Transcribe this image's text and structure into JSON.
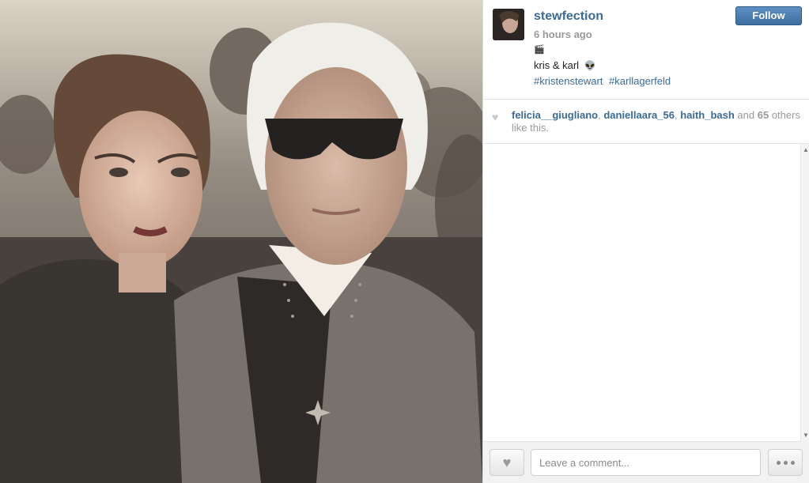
{
  "post": {
    "username": "stewfection",
    "time_ago": "6 hours ago",
    "clapper_emoji": "🎬",
    "caption": "kris & karl",
    "caption_emoji": "👽",
    "hashtags": [
      "#kristenstewart",
      "#karllagerfeld"
    ]
  },
  "header": {
    "follow_label": "Follow"
  },
  "likes": {
    "likers": [
      "felicia__giugliano",
      "daniellaara_56",
      "haith_bash"
    ],
    "separator": ", ",
    "and_text": " and ",
    "count": "65",
    "suffix": " others like this."
  },
  "comment": {
    "placeholder": "Leave a comment..."
  },
  "icons": {
    "like": "heart-icon",
    "more": "ellipsis-icon",
    "likes_heart": "heart-icon"
  },
  "colors": {
    "link": "#3b6b94",
    "follow_button": "#4a7db3",
    "muted": "#9a9a9a"
  }
}
